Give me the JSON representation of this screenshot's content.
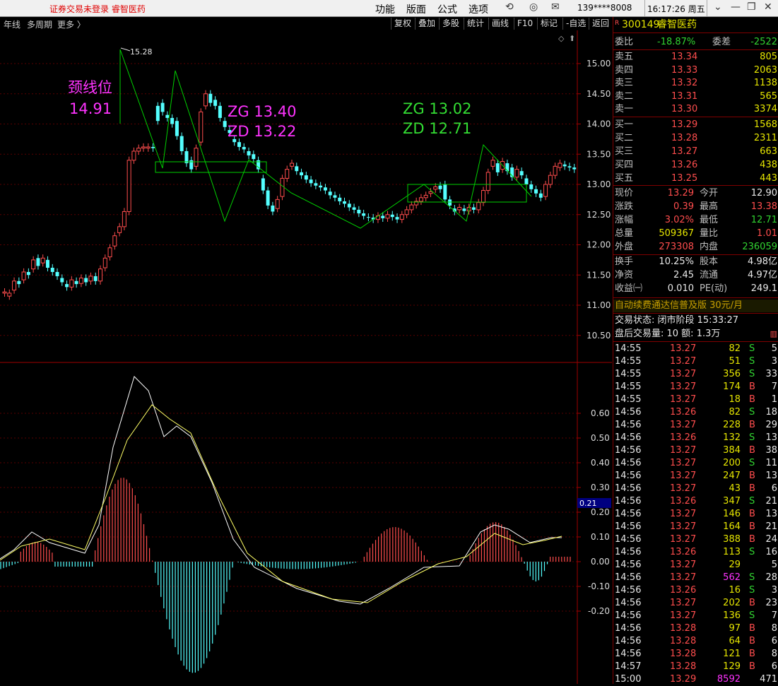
{
  "topbar": {
    "warning": "证券交易未登录 睿智医药",
    "menu": [
      "功能",
      "版面",
      "公式",
      "选项"
    ],
    "account": "139****8008",
    "time": "16:17:26 周五"
  },
  "toolbar": {
    "left": [
      "年线",
      "多周期",
      "更多 〉"
    ],
    "buttons": [
      "复权",
      "叠加",
      "多股",
      "统计",
      "画线",
      "F10",
      "标记",
      "-自选",
      "返回"
    ]
  },
  "annotations": {
    "neckline_label": "颈线位",
    "neckline_value": "14.91",
    "zg1": "ZG 13.40",
    "zd1": "ZD 13.22",
    "zg2": "ZG 13.02",
    "zd2": "ZD 12.71",
    "high_label": "15.28"
  },
  "price_axis": [
    "15.00",
    "14.50",
    "14.00",
    "13.50",
    "13.00",
    "12.50",
    "12.00",
    "11.50",
    "11.00",
    "10.50"
  ],
  "macd_axis": [
    "0.60",
    "0.50",
    "0.40",
    "0.30",
    "0.20",
    "0.10",
    "0.00",
    "-0.10",
    "-0.20"
  ],
  "macd_current": "0.21",
  "stock": {
    "code": "300149",
    "name": "睿智医药",
    "badge": "R"
  },
  "ratio": {
    "label1": "委比",
    "value1": "-18.87%",
    "label2": "委差",
    "value2": "-2522"
  },
  "asks": [
    {
      "label": "卖五",
      "price": "13.34",
      "vol": "805"
    },
    {
      "label": "卖四",
      "price": "13.33",
      "vol": "2063"
    },
    {
      "label": "卖三",
      "price": "13.32",
      "vol": "1138"
    },
    {
      "label": "卖二",
      "price": "13.31",
      "vol": "565"
    },
    {
      "label": "卖一",
      "price": "13.30",
      "vol": "3374"
    }
  ],
  "bids": [
    {
      "label": "买一",
      "price": "13.29",
      "vol": "1568"
    },
    {
      "label": "买二",
      "price": "13.28",
      "vol": "2311"
    },
    {
      "label": "买三",
      "price": "13.27",
      "vol": "663"
    },
    {
      "label": "买四",
      "price": "13.26",
      "vol": "438"
    },
    {
      "label": "买五",
      "price": "13.25",
      "vol": "443"
    }
  ],
  "quote": [
    {
      "l1": "现价",
      "v1": "13.29",
      "c1": "red",
      "l2": "今开",
      "v2": "12.90",
      "c2": "wht"
    },
    {
      "l1": "涨跌",
      "v1": "0.39",
      "c1": "red",
      "l2": "最高",
      "v2": "13.38",
      "c2": "red"
    },
    {
      "l1": "涨幅",
      "v1": "3.02%",
      "c1": "red",
      "l2": "最低",
      "v2": "12.71",
      "c2": "grn"
    },
    {
      "l1": "总量",
      "v1": "509367",
      "c1": "yel",
      "l2": "量比",
      "v2": "1.01",
      "c2": "red"
    },
    {
      "l1": "外盘",
      "v1": "273308",
      "c1": "red",
      "l2": "内盘",
      "v2": "236059",
      "c2": "grn"
    }
  ],
  "fundamentals": [
    {
      "l1": "换手",
      "v1": "10.25%",
      "l2": "股本",
      "v2": "4.98亿"
    },
    {
      "l1": "净资",
      "v1": "2.45",
      "l2": "流通",
      "v2": "4.97亿"
    },
    {
      "l1": "收益㈠",
      "v1": "0.010",
      "l2": "PE(动)",
      "v2": "249.1"
    }
  ],
  "promo": "自动续费通达信普及版  30元/月",
  "trade_status": "交易状态: 闭市阶段 15:33:27",
  "after_hours": "盘后交易量: 10  额: 1.3万",
  "ticks": [
    {
      "t": "14:55",
      "p": "13.27",
      "v": "82",
      "s": "S",
      "n": "5"
    },
    {
      "t": "14:55",
      "p": "13.27",
      "v": "51",
      "s": "S",
      "n": "3"
    },
    {
      "t": "14:55",
      "p": "13.27",
      "v": "356",
      "s": "S",
      "n": "33"
    },
    {
      "t": "14:55",
      "p": "13.27",
      "v": "174",
      "s": "B",
      "n": "7"
    },
    {
      "t": "14:55",
      "p": "13.27",
      "v": "18",
      "s": "B",
      "n": "1"
    },
    {
      "t": "14:56",
      "p": "13.26",
      "v": "82",
      "s": "S",
      "n": "18"
    },
    {
      "t": "14:56",
      "p": "13.27",
      "v": "228",
      "s": "B",
      "n": "29"
    },
    {
      "t": "14:56",
      "p": "13.26",
      "v": "132",
      "s": "S",
      "n": "13"
    },
    {
      "t": "14:56",
      "p": "13.27",
      "v": "384",
      "s": "B",
      "n": "38"
    },
    {
      "t": "14:56",
      "p": "13.27",
      "v": "200",
      "s": "S",
      "n": "11"
    },
    {
      "t": "14:56",
      "p": "13.27",
      "v": "247",
      "s": "B",
      "n": "13"
    },
    {
      "t": "14:56",
      "p": "13.27",
      "v": "43",
      "s": "B",
      "n": "6"
    },
    {
      "t": "14:56",
      "p": "13.26",
      "v": "347",
      "s": "S",
      "n": "21"
    },
    {
      "t": "14:56",
      "p": "13.27",
      "v": "146",
      "s": "B",
      "n": "13"
    },
    {
      "t": "14:56",
      "p": "13.27",
      "v": "164",
      "s": "B",
      "n": "21"
    },
    {
      "t": "14:56",
      "p": "13.27",
      "v": "388",
      "s": "B",
      "n": "24"
    },
    {
      "t": "14:56",
      "p": "13.26",
      "v": "113",
      "s": "S",
      "n": "16"
    },
    {
      "t": "14:56",
      "p": "13.27",
      "v": "29",
      "s": "",
      "n": "5"
    },
    {
      "t": "14:56",
      "p": "13.27",
      "v": "562",
      "s": "S",
      "n": "28"
    },
    {
      "t": "14:56",
      "p": "13.26",
      "v": "16",
      "s": "S",
      "n": "3"
    },
    {
      "t": "14:56",
      "p": "13.27",
      "v": "202",
      "s": "B",
      "n": "23"
    },
    {
      "t": "14:56",
      "p": "13.27",
      "v": "136",
      "s": "S",
      "n": "7"
    },
    {
      "t": "14:56",
      "p": "13.28",
      "v": "97",
      "s": "B",
      "n": "8"
    },
    {
      "t": "14:56",
      "p": "13.28",
      "v": "64",
      "s": "B",
      "n": "6"
    },
    {
      "t": "14:56",
      "p": "13.28",
      "v": "121",
      "s": "B",
      "n": "8"
    },
    {
      "t": "14:57",
      "p": "13.28",
      "v": "129",
      "s": "B",
      "n": "6"
    },
    {
      "t": "15:00",
      "p": "13.29",
      "v": "8592",
      "s": "",
      "n": "471"
    }
  ],
  "colors": {
    "up": "#ff4d4d",
    "down": "#54ffff",
    "zone": "#00d000",
    "dif": "#ffffff",
    "dea": "#ffff66",
    "annotate_mag": "#ff33ff",
    "annotate_grn": "#33dd33"
  }
}
